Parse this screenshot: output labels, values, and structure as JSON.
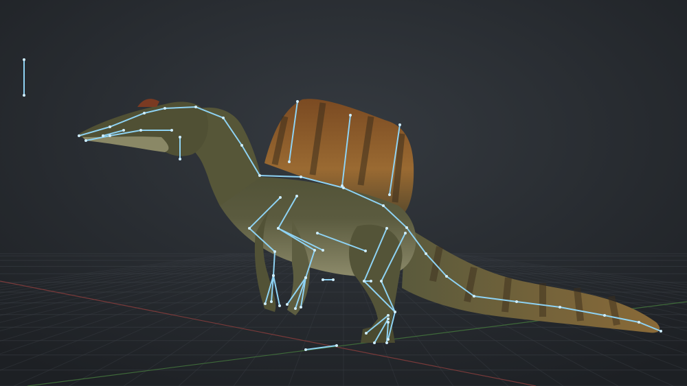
{
  "viewport": {
    "background_top": "#2e3237",
    "background_bottom": "#1e2125",
    "grid_color": "#3a3f45",
    "axis_x_color": "#7a3a3a",
    "axis_z_color": "#3f6a3a"
  },
  "model": {
    "name": "",
    "body_color": "#5a5a3c",
    "belly_color": "#8c8a6a",
    "sail_color": "#8a5a2a",
    "stripe_color": "#3c2e1c",
    "crest_color": "#7a3a22"
  },
  "rig": {
    "bone_color": "#8fd3f4",
    "joint_color": "#cfeeff"
  },
  "widgets": {
    "left_marker_icon": "bone-marker-icon"
  }
}
